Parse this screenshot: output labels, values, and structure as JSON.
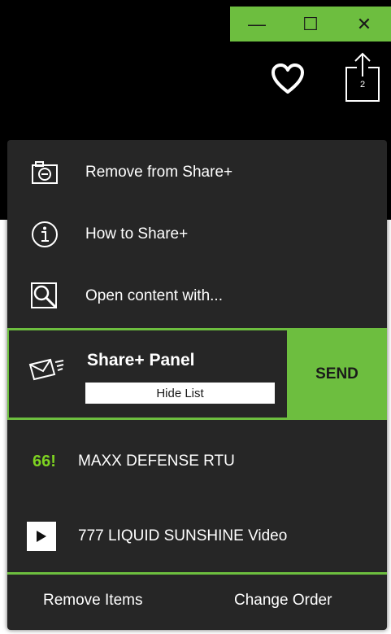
{
  "window_controls": {
    "minimize": "—",
    "maximize": "☐",
    "close": "✕"
  },
  "toolbar": {
    "favorite_icon": "heart-outline-icon",
    "share_icon": "share-upload-icon",
    "share_count": "2"
  },
  "menu": {
    "items": [
      {
        "label": "Remove from Share+",
        "icon": "camera-remove-icon"
      },
      {
        "label": "How to Share+",
        "icon": "info-icon"
      },
      {
        "label": "Open content with...",
        "icon": "magnifier-icon"
      }
    ]
  },
  "share_panel": {
    "title": "Share+ Panel",
    "hide_list_label": "Hide List",
    "send_label": "SEND",
    "icon": "envelope-icon"
  },
  "list": {
    "items": [
      {
        "badge": "66!",
        "label": "MAXX DEFENSE RTU"
      },
      {
        "icon": "play-icon",
        "label": "777 LIQUID SUNSHINE Video"
      }
    ]
  },
  "footer": {
    "remove_label": "Remove Items",
    "order_label": "Change Order"
  },
  "colors": {
    "accent": "#6dbe3f",
    "panel": "#262626",
    "background": "#000000"
  }
}
